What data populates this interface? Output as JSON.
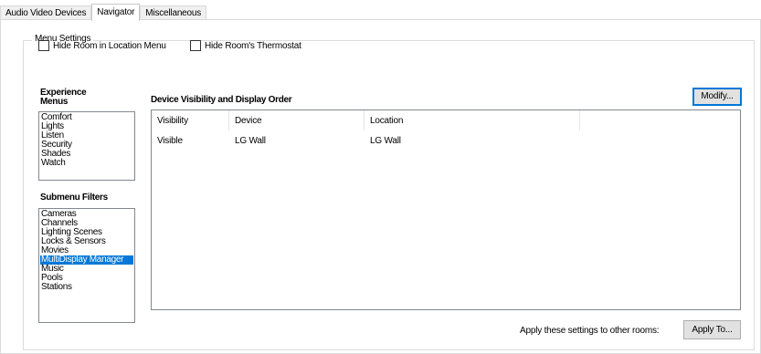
{
  "tabs": [
    {
      "label": "Audio Video Devices",
      "active": false
    },
    {
      "label": "Navigator",
      "active": true
    },
    {
      "label": "Miscellaneous",
      "active": false
    }
  ],
  "menu_settings": {
    "legend": "Menu Settings",
    "hide_room_location_label": "Hide Room in Location Menu",
    "hide_room_location_checked": false,
    "hide_thermostat_label": "Hide Room's Thermostat",
    "hide_thermostat_checked": false
  },
  "experience_menus": {
    "heading": "Experience Menus",
    "items": [
      "Comfort",
      "Lights",
      "Listen",
      "Security",
      "Shades",
      "Watch"
    ]
  },
  "submenu_filters": {
    "heading": "Submenu Filters",
    "items": [
      "Cameras",
      "Channels",
      "Lighting Scenes",
      "Locks & Sensors",
      "Movies",
      "MultiDisplay Manager",
      "Music",
      "Pools",
      "Stations"
    ],
    "selected": "MultiDisplay Manager"
  },
  "device_visibility": {
    "heading": "Device Visibility and Display Order",
    "modify_label": "Modify...",
    "columns": [
      "Visibility",
      "Device",
      "Location",
      ""
    ],
    "rows": [
      [
        "Visible",
        "LG Wall",
        "LG Wall",
        ""
      ]
    ]
  },
  "apply": {
    "label": "Apply these settings to other rooms:",
    "button_label": "Apply To..."
  }
}
